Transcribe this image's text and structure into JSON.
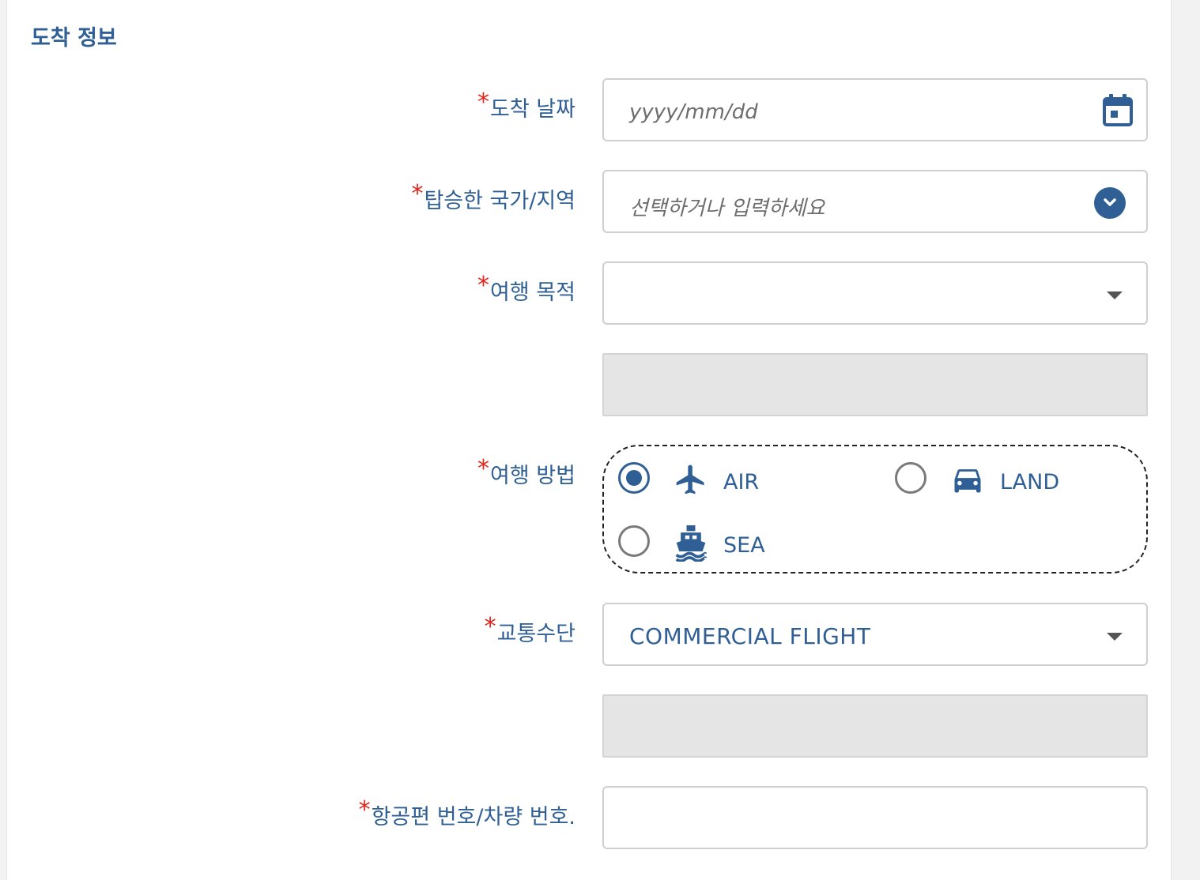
{
  "section": {
    "title": "도착 정보"
  },
  "required_mark": "*",
  "fields": {
    "arrival_date": {
      "label": "도착 날짜",
      "placeholder": "yyyy/mm/dd",
      "icon": "calendar-icon"
    },
    "boarding_country": {
      "label": "탑승한 국가/지역",
      "placeholder": "선택하거나 입력하세요",
      "icon": "chevron-down-circle-icon"
    },
    "travel_purpose": {
      "label": "여행 목적",
      "value": ""
    },
    "travel_method": {
      "label": "여행 방법",
      "options": [
        {
          "label": "AIR",
          "icon": "airplane-icon",
          "selected": true
        },
        {
          "label": "LAND",
          "icon": "car-icon",
          "selected": false
        },
        {
          "label": "SEA",
          "icon": "ship-icon",
          "selected": false
        }
      ]
    },
    "transport": {
      "label": "교통수단",
      "value": "COMMERCIAL FLIGHT"
    },
    "flight_number": {
      "label": "항공편 번호/차량 번호.",
      "value": ""
    }
  },
  "colors": {
    "primary": "#2f5f95",
    "required": "#e2231a",
    "disabled_bg": "#e5e5e5"
  }
}
